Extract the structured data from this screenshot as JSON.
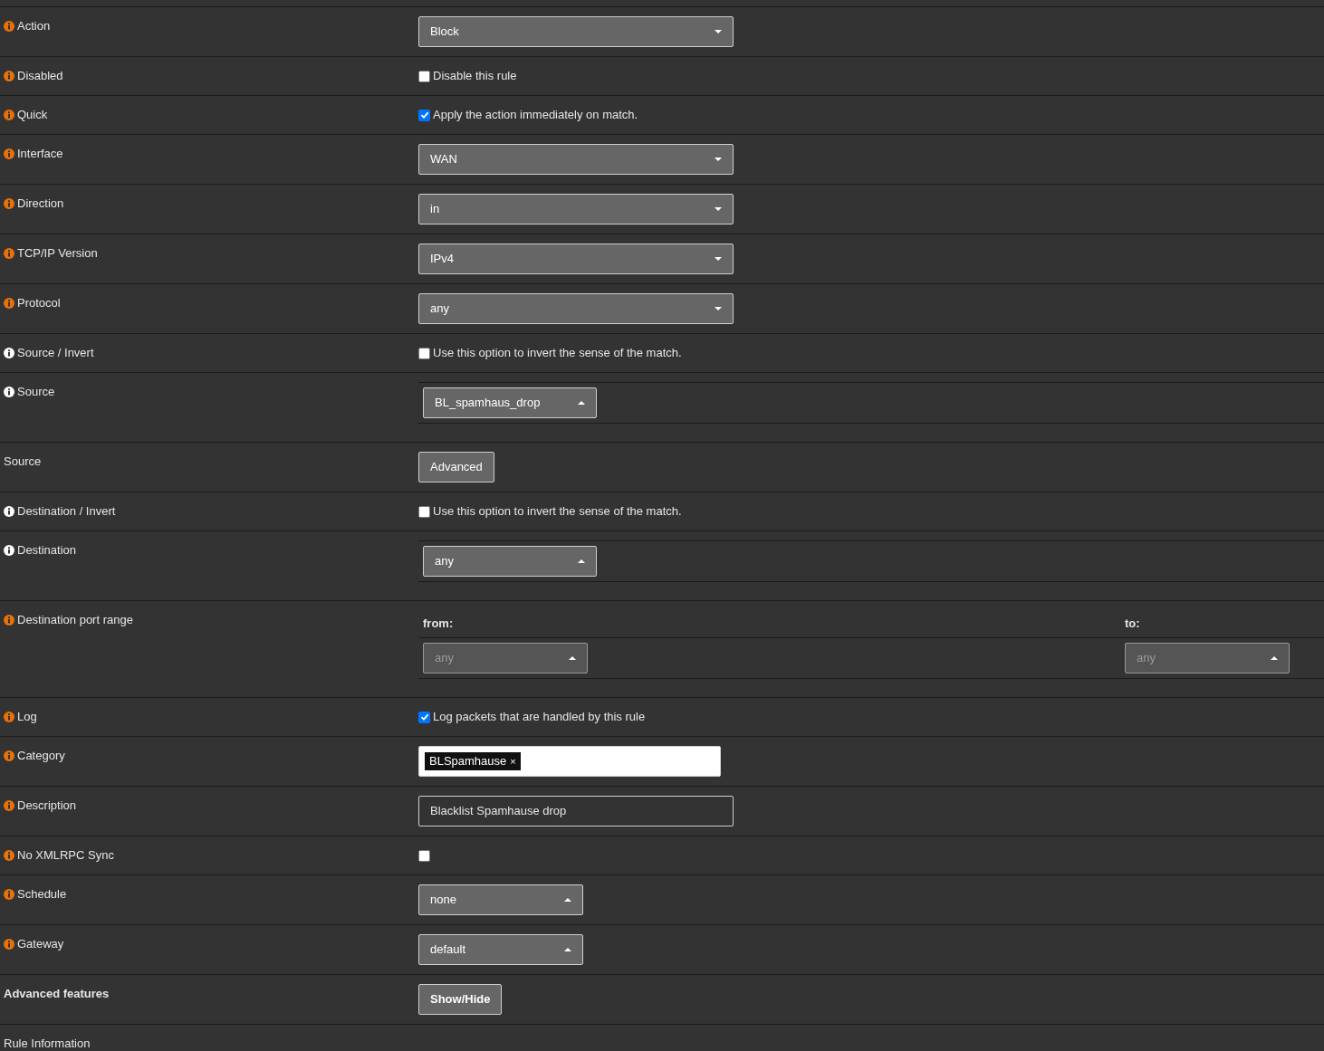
{
  "rows": [
    {
      "label": "Action",
      "label_bold": false,
      "color": "#e8710a",
      "kind": "select",
      "select": {
        "value": "Block",
        "caret_up": false,
        "disabled": false
      }
    },
    {
      "label": "Disabled",
      "label_bold": false,
      "color": "#e8710a",
      "kind": "checkbox",
      "checkbox": {
        "text": "Disable this rule",
        "checked": false
      }
    },
    {
      "label": "Quick",
      "label_bold": false,
      "color": "#e8710a",
      "kind": "checkbox",
      "checkbox": {
        "text": "Apply the action immediately on match.",
        "checked": true
      }
    },
    {
      "label": "Interface",
      "label_bold": false,
      "color": "#e8710a",
      "kind": "select",
      "select": {
        "value": "WAN",
        "caret_up": false,
        "disabled": false
      }
    },
    {
      "label": "Direction",
      "label_bold": false,
      "color": "#e8710a",
      "kind": "select",
      "select": {
        "value": "in",
        "caret_up": false,
        "disabled": false
      }
    },
    {
      "label": "TCP/IP Version",
      "label_bold": false,
      "color": "#e8710a",
      "kind": "select",
      "select": {
        "value": "IPv4",
        "caret_up": false,
        "disabled": false
      }
    },
    {
      "label": "Protocol",
      "label_bold": false,
      "color": "#e8710a",
      "kind": "select",
      "select": {
        "value": "any",
        "caret_up": false,
        "disabled": false
      }
    },
    {
      "label": "Source / Invert",
      "label_bold": false,
      "color": "#ffffff",
      "kind": "checkbox",
      "checkbox": {
        "text": "Use this option to invert the sense of the match.",
        "checked": false
      }
    },
    {
      "label": "Source",
      "label_bold": false,
      "color": "#ffffff",
      "kind": "network",
      "select": {
        "value": "BL_spamhaus_drop",
        "caret_up": true,
        "disabled": false
      }
    },
    {
      "label": "Source",
      "label_bold": false,
      "kind": "button",
      "button": {
        "text": "Advanced",
        "bold": false
      }
    },
    {
      "label": "Destination / Invert",
      "label_bold": false,
      "color": "#ffffff",
      "kind": "checkbox",
      "checkbox": {
        "text": "Use this option to invert the sense of the match.",
        "checked": false
      }
    },
    {
      "label": "Destination",
      "label_bold": false,
      "color": "#ffffff",
      "kind": "network",
      "select": {
        "value": "any",
        "caret_up": true,
        "disabled": false
      }
    },
    {
      "label": "Destination port range",
      "label_bold": false,
      "color": "#e8710a",
      "kind": "port_range",
      "from": {
        "label": "from:",
        "value": "any",
        "caret_up": true,
        "disabled": true
      },
      "to": {
        "label": "to:",
        "value": "any",
        "caret_up": true,
        "disabled": true
      }
    },
    {
      "label": "Log",
      "label_bold": false,
      "color": "#e8710a",
      "kind": "checkbox",
      "checkbox": {
        "text": "Log packets that are handled by this rule",
        "checked": true
      }
    },
    {
      "label": "Category",
      "label_bold": false,
      "color": "#e8710a",
      "kind": "tags",
      "tags": [
        "BLSpamhause"
      ],
      "tag_remove": "×"
    },
    {
      "label": "Description",
      "label_bold": false,
      "color": "#e8710a",
      "kind": "text",
      "value": "Blacklist Spamhause drop"
    },
    {
      "label": "No XMLRPC Sync",
      "label_bold": false,
      "color": "#e8710a",
      "kind": "checkbox",
      "checkbox": {
        "checked": false
      }
    },
    {
      "label": "Schedule",
      "label_bold": false,
      "color": "#e8710a",
      "kind": "small_select",
      "select": {
        "value": "none",
        "caret_up": true,
        "disabled": false
      }
    },
    {
      "label": "Gateway",
      "label_bold": false,
      "color": "#e8710a",
      "kind": "small_select",
      "select": {
        "value": "default",
        "caret_up": true,
        "disabled": false
      }
    },
    {
      "label": "Advanced features",
      "label_bold": true,
      "kind": "button",
      "button": {
        "text": "Show/Hide",
        "bold": true
      }
    },
    {
      "label": "Rule Information",
      "label_bold": false,
      "kind": "heading"
    }
  ]
}
